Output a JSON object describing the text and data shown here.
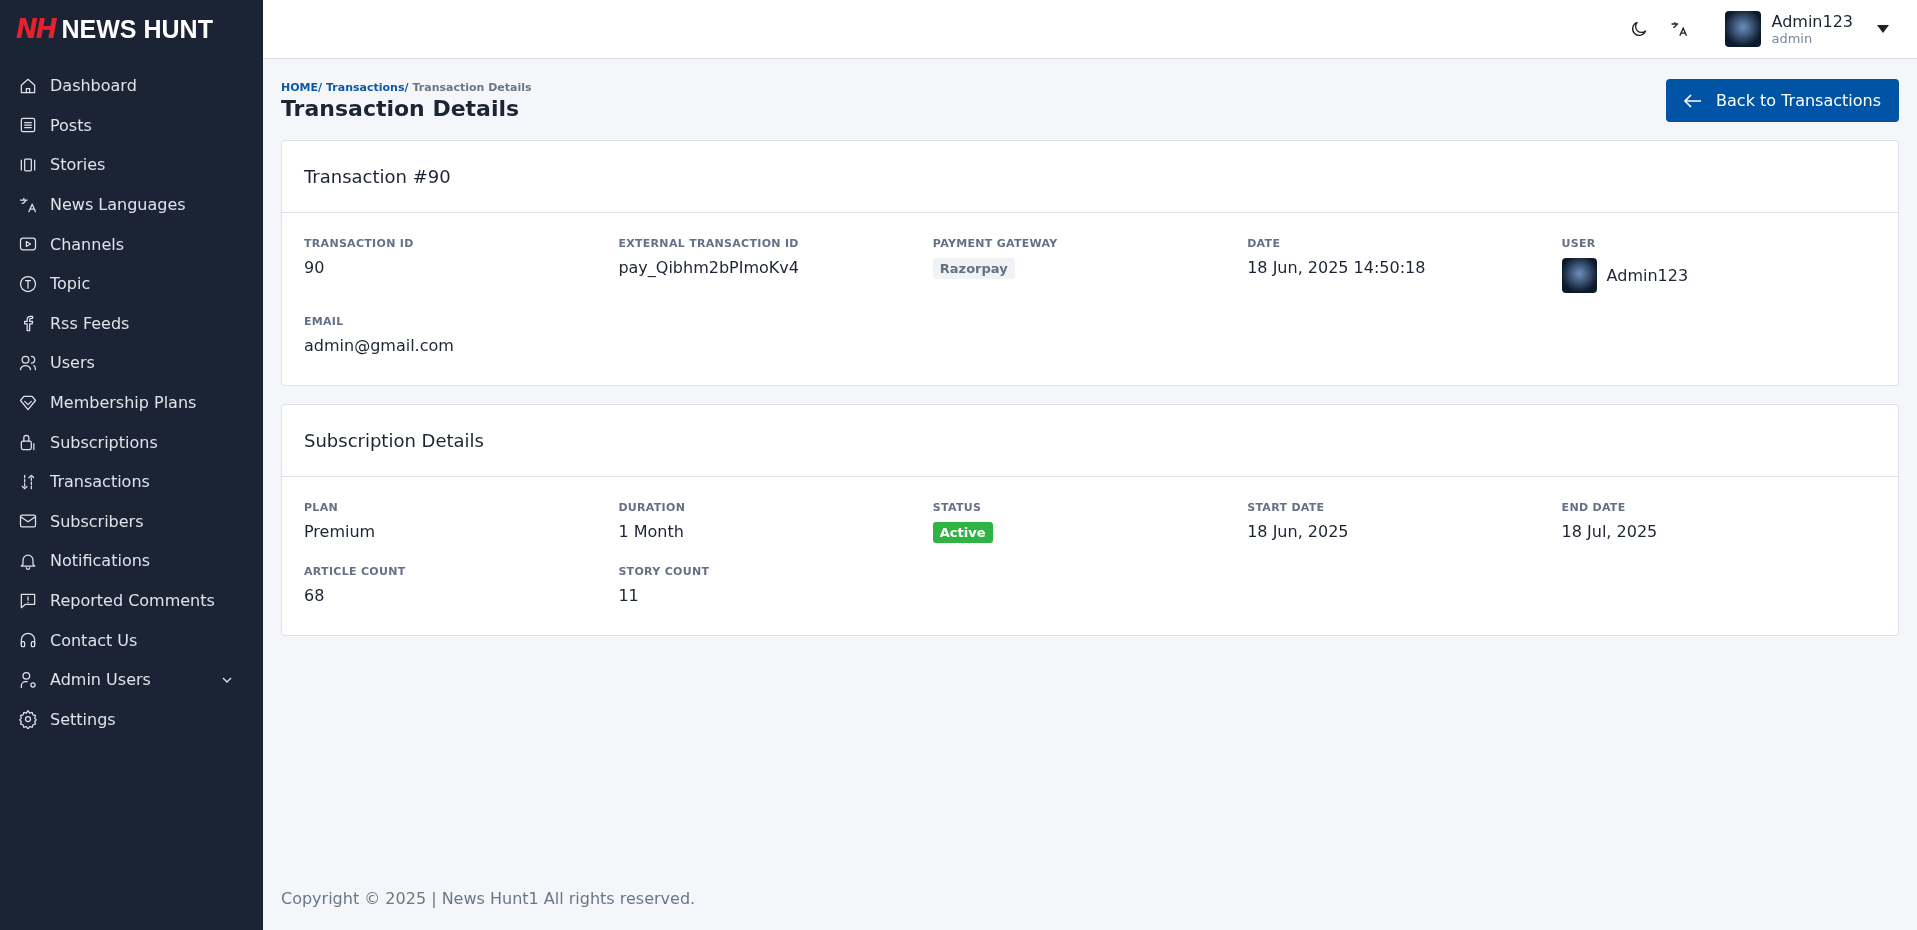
{
  "brand": {
    "mark": "NH",
    "name": "NEWS HUNT"
  },
  "sidebar": {
    "items": [
      {
        "label": "Dashboard"
      },
      {
        "label": "Posts"
      },
      {
        "label": "Stories"
      },
      {
        "label": "News Languages"
      },
      {
        "label": "Channels"
      },
      {
        "label": "Topic"
      },
      {
        "label": "Rss Feeds"
      },
      {
        "label": "Users"
      },
      {
        "label": "Membership Plans"
      },
      {
        "label": "Subscriptions"
      },
      {
        "label": "Transactions"
      },
      {
        "label": "Subscribers"
      },
      {
        "label": "Notifications"
      },
      {
        "label": "Reported Comments"
      },
      {
        "label": "Contact Us"
      },
      {
        "label": "Admin Users",
        "expanded": false
      },
      {
        "label": "Settings"
      }
    ]
  },
  "header": {
    "user": {
      "name": "Admin123",
      "role": "admin"
    }
  },
  "breadcrumb": [
    "HOME/",
    "Transactions/",
    "Transaction Details"
  ],
  "page_title": "Transaction Details",
  "back_button": "Back to Transactions",
  "cards": [
    {
      "title": "Transaction #90",
      "fields": [
        {
          "label": "TRANSACTION ID",
          "value": "90",
          "kind": "text"
        },
        {
          "label": "EXTERNAL TRANSACTION ID",
          "value": "pay_Qibhm2bPImoKv4",
          "kind": "text"
        },
        {
          "label": "PAYMENT GATEWAY",
          "value": "Razorpay",
          "kind": "tag"
        },
        {
          "label": "DATE",
          "value": "18 Jun, 2025 14:50:18",
          "kind": "text"
        },
        {
          "label": "USER",
          "value": "Admin123",
          "kind": "user"
        },
        {
          "label": "EMAIL",
          "value": "admin@gmail.com",
          "kind": "text"
        }
      ]
    },
    {
      "title": "Subscription Details",
      "fields": [
        {
          "label": "PLAN",
          "value": "Premium",
          "kind": "text"
        },
        {
          "label": "DURATION",
          "value": "1 Month",
          "kind": "text"
        },
        {
          "label": "STATUS",
          "value": "Active",
          "kind": "status",
          "color": "#2fb344"
        },
        {
          "label": "START DATE",
          "value": "18 Jun, 2025",
          "kind": "text"
        },
        {
          "label": "END DATE",
          "value": "18 Jul, 2025",
          "kind": "text"
        },
        {
          "label": "ARTICLE COUNT",
          "value": "68",
          "kind": "text"
        },
        {
          "label": "STORY COUNT",
          "value": "11",
          "kind": "text"
        }
      ]
    }
  ],
  "footer": "Copyright © 2025 | News Hunt1 All rights reserved."
}
